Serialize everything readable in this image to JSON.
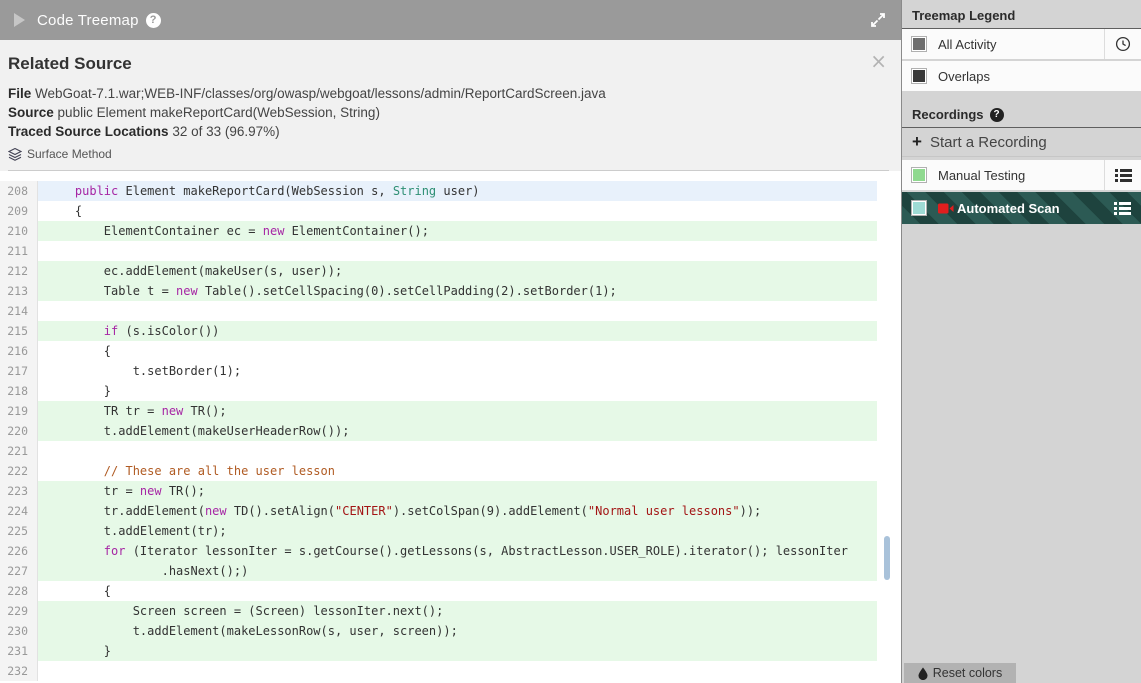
{
  "titlebar": {
    "title": "Code Treemap",
    "help": "?"
  },
  "related_source": {
    "title": "Related Source",
    "close": "×",
    "fields": [
      {
        "label": "File",
        "value": "WebGoat-7.1.war;WEB-INF/classes/org/owasp/webgoat/lessons/admin/ReportCardScreen.java"
      },
      {
        "label": "Source",
        "value": "public Element makeReportCard(WebSession, String)"
      },
      {
        "label": "Traced Source Locations",
        "value": "32 of 33 (96.97%)"
      }
    ],
    "tag": "Surface Method"
  },
  "code": {
    "lines": [
      {
        "n": 208,
        "hl": "b",
        "tokens": [
          [
            "p",
            "    "
          ],
          [
            "k",
            "public"
          ],
          [
            "p",
            " Element makeReportCard(WebSession s, "
          ],
          [
            "t",
            "String"
          ],
          [
            "p",
            " user)"
          ]
        ]
      },
      {
        "n": 209,
        "hl": "w",
        "tokens": [
          [
            "p",
            "    {"
          ]
        ]
      },
      {
        "n": 210,
        "hl": "g",
        "tokens": [
          [
            "p",
            "        ElementContainer ec = "
          ],
          [
            "k",
            "new"
          ],
          [
            "p",
            " ElementContainer();"
          ]
        ]
      },
      {
        "n": 211,
        "hl": "w",
        "tokens": []
      },
      {
        "n": 212,
        "hl": "g",
        "tokens": [
          [
            "p",
            "        ec.addElement(makeUser(s, user));"
          ]
        ]
      },
      {
        "n": 213,
        "hl": "g",
        "tokens": [
          [
            "p",
            "        Table t = "
          ],
          [
            "k",
            "new"
          ],
          [
            "p",
            " Table().setCellSpacing(0).setCellPadding(2).setBorder(1);"
          ]
        ]
      },
      {
        "n": 214,
        "hl": "w",
        "tokens": []
      },
      {
        "n": 215,
        "hl": "g",
        "tokens": [
          [
            "p",
            "        "
          ],
          [
            "k",
            "if"
          ],
          [
            "p",
            " (s.isColor())"
          ]
        ]
      },
      {
        "n": 216,
        "hl": "w",
        "tokens": [
          [
            "p",
            "        {"
          ]
        ]
      },
      {
        "n": 217,
        "hl": "w",
        "tokens": [
          [
            "p",
            "            t.setBorder(1);"
          ]
        ]
      },
      {
        "n": 218,
        "hl": "w",
        "tokens": [
          [
            "p",
            "        }"
          ]
        ]
      },
      {
        "n": 219,
        "hl": "g",
        "tokens": [
          [
            "p",
            "        TR tr = "
          ],
          [
            "k",
            "new"
          ],
          [
            "p",
            " TR();"
          ]
        ]
      },
      {
        "n": 220,
        "hl": "g",
        "tokens": [
          [
            "p",
            "        t.addElement(makeUserHeaderRow());"
          ]
        ]
      },
      {
        "n": 221,
        "hl": "w",
        "tokens": []
      },
      {
        "n": 222,
        "hl": "w",
        "tokens": [
          [
            "p",
            "        "
          ],
          [
            "c",
            "// These are all the user lesson"
          ]
        ]
      },
      {
        "n": 223,
        "hl": "g",
        "tokens": [
          [
            "p",
            "        tr = "
          ],
          [
            "k",
            "new"
          ],
          [
            "p",
            " TR();"
          ]
        ]
      },
      {
        "n": 224,
        "hl": "g",
        "tokens": [
          [
            "p",
            "        tr.addElement("
          ],
          [
            "k",
            "new"
          ],
          [
            "p",
            " TD().setAlign("
          ],
          [
            "s",
            "\"CENTER\""
          ],
          [
            "p",
            ").setColSpan(9).addElement("
          ],
          [
            "s",
            "\"Normal user lessons\""
          ],
          [
            "p",
            "));"
          ]
        ]
      },
      {
        "n": 225,
        "hl": "g",
        "tokens": [
          [
            "p",
            "        t.addElement(tr);"
          ]
        ]
      },
      {
        "n": 226,
        "hl": "g",
        "tokens": [
          [
            "p",
            "        "
          ],
          [
            "k",
            "for"
          ],
          [
            "p",
            " (Iterator lessonIter = s.getCourse().getLessons(s, AbstractLesson.USER_ROLE).iterator(); lessonIter"
          ]
        ]
      },
      {
        "n": 227,
        "hl": "g",
        "tokens": [
          [
            "p",
            "                .hasNext();)"
          ]
        ]
      },
      {
        "n": 228,
        "hl": "w",
        "tokens": [
          [
            "p",
            "        {"
          ]
        ]
      },
      {
        "n": 229,
        "hl": "g",
        "tokens": [
          [
            "p",
            "            Screen screen = (Screen) lessonIter.next();"
          ]
        ]
      },
      {
        "n": 230,
        "hl": "g",
        "tokens": [
          [
            "p",
            "            t.addElement(makeLessonRow(s, user, screen));"
          ]
        ]
      },
      {
        "n": 231,
        "hl": "g",
        "tokens": [
          [
            "p",
            "        }"
          ]
        ]
      },
      {
        "n": 232,
        "hl": "w",
        "tokens": []
      }
    ]
  },
  "sidebar": {
    "legend_heading": "Treemap Legend",
    "legend_items": [
      {
        "label": "All Activity",
        "swatch": "#6e6e6e",
        "clock": true
      },
      {
        "label": "Overlaps",
        "swatch": "#383838",
        "clock": false
      }
    ],
    "recordings_heading": "Recordings",
    "recordings_help": "?",
    "start_label": "Start a Recording",
    "start_plus": "+",
    "recording_items": [
      {
        "label": "Manual Testing",
        "swatch": "#8fd98f",
        "active": false,
        "camera": false
      },
      {
        "label": "Automated Scan",
        "swatch": "#9edbd5",
        "active": true,
        "camera": true
      }
    ],
    "reset_label": "Reset colors"
  },
  "colors": {
    "titlebar_bg": "#9a9a9a",
    "header_bg": "#f1f1f1",
    "highlight_green": "#e6f9e7",
    "highlight_blue": "#e8f1fb",
    "keyword": "#a626a4",
    "type": "#2e8f74",
    "string": "#a31515",
    "comment": "#b05b23",
    "active_stripe_dark": "#1e433e",
    "active_stripe_light": "#2c5a54",
    "camera_red": "#e01e1e",
    "scroll_thumb": "#a9c2da"
  }
}
